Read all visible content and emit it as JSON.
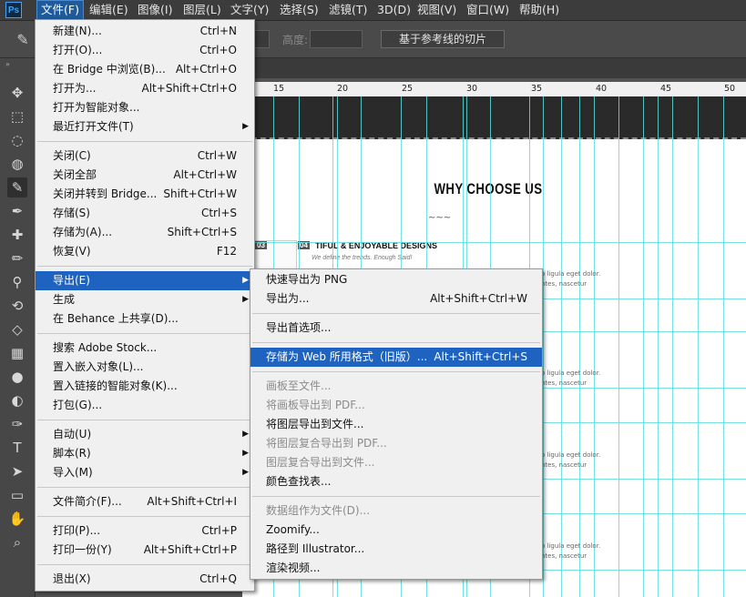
{
  "app": {
    "logo": "Ps"
  },
  "menubar": [
    {
      "label": "文件(F)",
      "active": true
    },
    {
      "label": "编辑(E)"
    },
    {
      "label": "图像(I)"
    },
    {
      "label": "图层(L)"
    },
    {
      "label": "文字(Y)"
    },
    {
      "label": "选择(S)"
    },
    {
      "label": "滤镜(T)"
    },
    {
      "label": "3D(D)"
    },
    {
      "label": "视图(V)"
    },
    {
      "label": "窗口(W)"
    },
    {
      "label": "帮助(H)"
    }
  ],
  "options": {
    "height_label": "高度:",
    "slice_button": "基于参考线的切片"
  },
  "toolbar": {
    "icons": [
      "move-icon",
      "marquee-icon",
      "lasso-icon",
      "quick-select-icon",
      "slice-icon",
      "eyedropper-icon",
      "healing-brush-icon",
      "brush-icon",
      "stamp-icon",
      "history-brush-icon",
      "eraser-icon",
      "gradient-icon",
      "blur-icon",
      "dodge-icon",
      "pen-icon",
      "type-icon",
      "path-select-icon",
      "rectangle-icon",
      "hand-icon",
      "zoom-icon"
    ]
  },
  "ruler": {
    "marks": [
      "15",
      "20",
      "25",
      "30",
      "35",
      "40",
      "45",
      "50"
    ]
  },
  "canvas": {
    "title": "WHY CHOOSE US",
    "squiggle": "~~~",
    "feature_num_left": "03",
    "feature_num": "04",
    "feature_title": "TIFUL & ENJOYABLE DESIGNS",
    "feature_sub": "We define the trends. Enough Said!",
    "lorem1": "o ligula eget dolor.",
    "lorem2": "ntes, nascetur"
  },
  "file_menu": {
    "items": [
      {
        "label": "新建(N)...",
        "shortcut": "Ctrl+N"
      },
      {
        "label": "打开(O)...",
        "shortcut": "Ctrl+O"
      },
      {
        "label": "在 Bridge 中浏览(B)...",
        "shortcut": "Alt+Ctrl+O"
      },
      {
        "label": "打开为...",
        "shortcut": "Alt+Shift+Ctrl+O"
      },
      {
        "label": "打开为智能对象...",
        "shortcut": ""
      },
      {
        "label": "最近打开文件(T)",
        "shortcut": "",
        "submenu": true
      },
      {
        "sep": true
      },
      {
        "label": "关闭(C)",
        "shortcut": "Ctrl+W"
      },
      {
        "label": "关闭全部",
        "shortcut": "Alt+Ctrl+W"
      },
      {
        "label": "关闭并转到 Bridge...",
        "shortcut": "Shift+Ctrl+W"
      },
      {
        "label": "存储(S)",
        "shortcut": "Ctrl+S"
      },
      {
        "label": "存储为(A)...",
        "shortcut": "Shift+Ctrl+S"
      },
      {
        "label": "恢复(V)",
        "shortcut": "F12"
      },
      {
        "sep": true
      },
      {
        "label": "导出(E)",
        "shortcut": "",
        "submenu": true,
        "highlighted": true
      },
      {
        "label": "生成",
        "shortcut": "",
        "submenu": true
      },
      {
        "label": "在 Behance 上共享(D)...",
        "shortcut": ""
      },
      {
        "sep": true
      },
      {
        "label": "搜索 Adobe Stock...",
        "shortcut": ""
      },
      {
        "label": "置入嵌入对象(L)...",
        "shortcut": ""
      },
      {
        "label": "置入链接的智能对象(K)...",
        "shortcut": ""
      },
      {
        "label": "打包(G)...",
        "shortcut": ""
      },
      {
        "sep": true
      },
      {
        "label": "自动(U)",
        "shortcut": "",
        "submenu": true
      },
      {
        "label": "脚本(R)",
        "shortcut": "",
        "submenu": true
      },
      {
        "label": "导入(M)",
        "shortcut": "",
        "submenu": true
      },
      {
        "sep": true
      },
      {
        "label": "文件简介(F)...",
        "shortcut": "Alt+Shift+Ctrl+I"
      },
      {
        "sep": true
      },
      {
        "label": "打印(P)...",
        "shortcut": "Ctrl+P"
      },
      {
        "label": "打印一份(Y)",
        "shortcut": "Alt+Shift+Ctrl+P"
      },
      {
        "sep": true
      },
      {
        "label": "退出(X)",
        "shortcut": "Ctrl+Q"
      }
    ]
  },
  "export_menu": {
    "items": [
      {
        "label": "快速导出为 PNG",
        "shortcut": ""
      },
      {
        "label": "导出为...",
        "shortcut": "Alt+Shift+Ctrl+W"
      },
      {
        "sep": true
      },
      {
        "label": "导出首选项...",
        "shortcut": ""
      },
      {
        "sep": true
      },
      {
        "label": "存储为 Web 所用格式（旧版）...",
        "shortcut": "Alt+Shift+Ctrl+S",
        "highlighted": true
      },
      {
        "sep": true
      },
      {
        "label": "画板至文件...",
        "shortcut": "",
        "disabled": true
      },
      {
        "label": "将画板导出到 PDF...",
        "shortcut": "",
        "disabled": true
      },
      {
        "label": "将图层导出到文件...",
        "shortcut": ""
      },
      {
        "label": "将图层复合导出到 PDF...",
        "shortcut": "",
        "disabled": true
      },
      {
        "label": "图层复合导出到文件...",
        "shortcut": "",
        "disabled": true
      },
      {
        "label": "颜色查找表...",
        "shortcut": ""
      },
      {
        "sep": true
      },
      {
        "label": "数据组作为文件(D)...",
        "shortcut": "",
        "disabled": true
      },
      {
        "label": "Zoomify...",
        "shortcut": ""
      },
      {
        "label": "路径到 Illustrator...",
        "shortcut": ""
      },
      {
        "label": "渲染视频...",
        "shortcut": ""
      }
    ]
  },
  "colors": {
    "menu_highlight": "#1e63bf",
    "guides": "#5fdde0",
    "menubar_bg": "#3c3c3c"
  }
}
